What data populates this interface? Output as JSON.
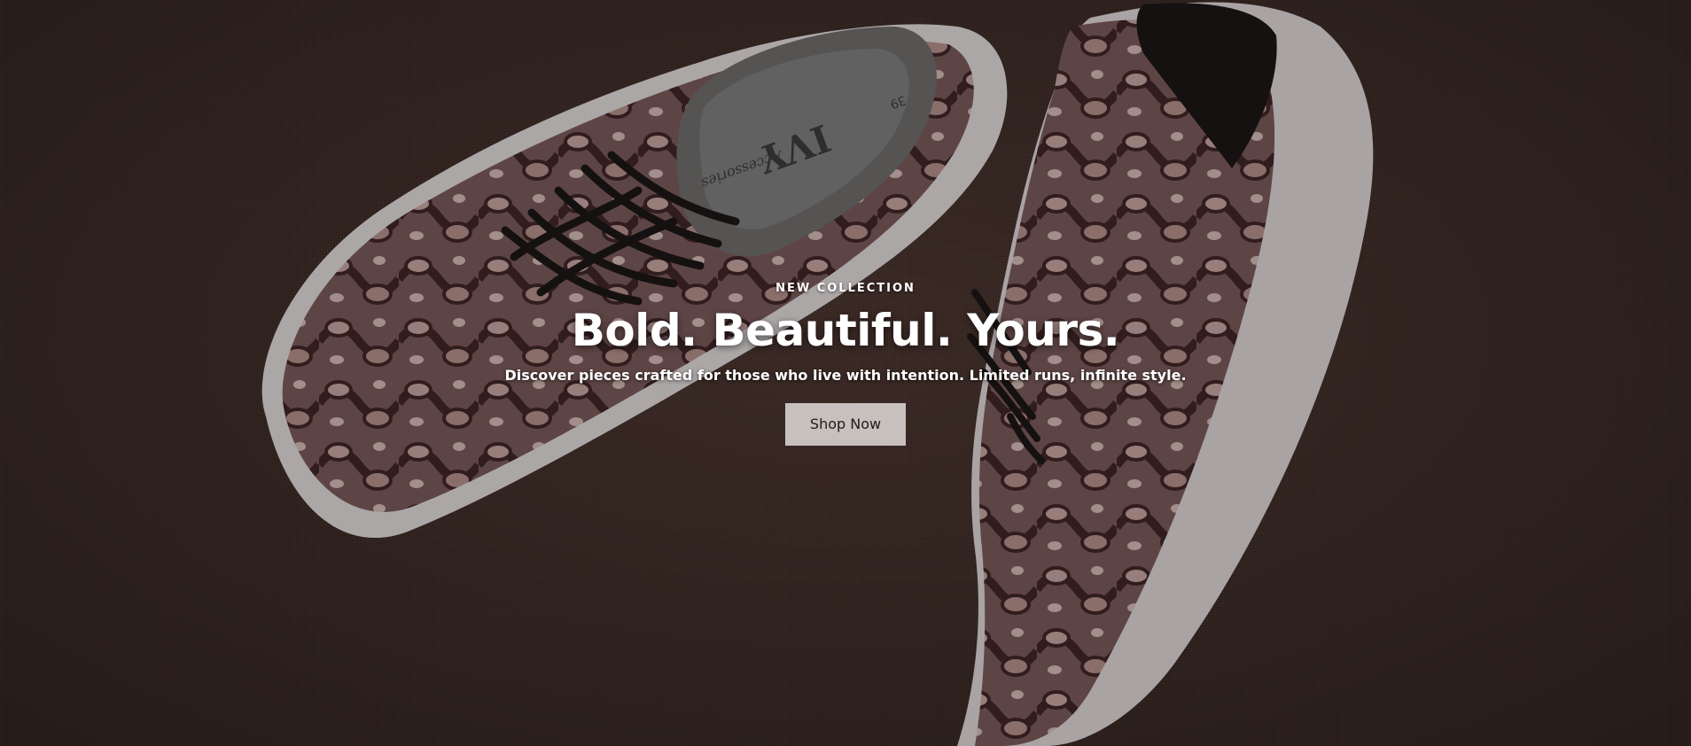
{
  "hero": {
    "eyebrow": "NEW COLLECTION",
    "headline": "Bold. Beautiful. Yours.",
    "subhead": "Discover pieces crafted for those who live with intention. Limited runs, infinite style.",
    "cta_label": "Shop Now",
    "image_brand": "IVY",
    "image_brand_sub": "Accessories",
    "image_size": "39"
  },
  "colors": {
    "background": "#3a2a26",
    "cta_bg": "#c7c0bd",
    "cta_text": "#1e1b1a",
    "text": "#ffffff"
  }
}
